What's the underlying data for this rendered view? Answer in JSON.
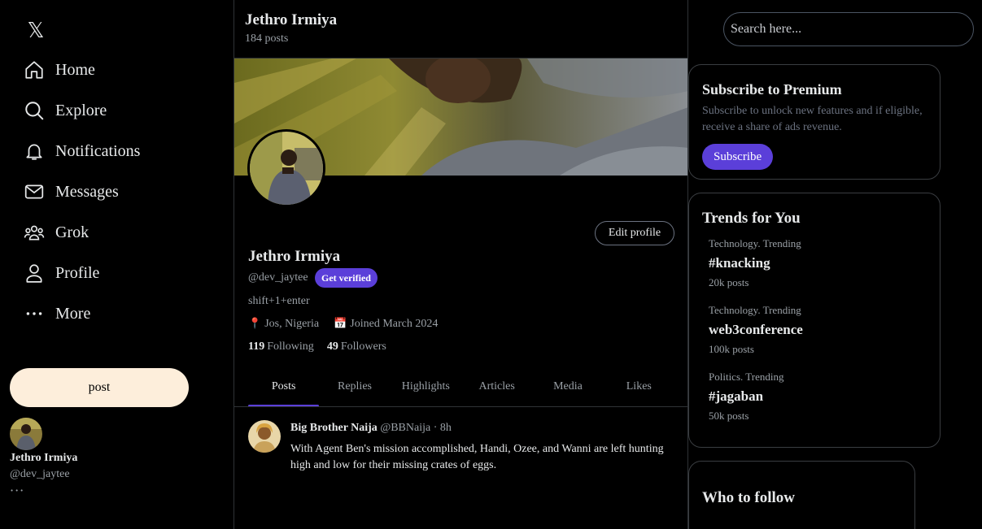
{
  "sidebar": {
    "logo": "𝕏",
    "items": [
      {
        "label": "Home",
        "icon": "home-icon"
      },
      {
        "label": "Explore",
        "icon": "search-icon"
      },
      {
        "label": "Notifications",
        "icon": "bell-icon"
      },
      {
        "label": "Messages",
        "icon": "mail-icon"
      },
      {
        "label": "Grok",
        "icon": "people-icon"
      },
      {
        "label": "Profile",
        "icon": "user-icon"
      },
      {
        "label": "More",
        "icon": "more-icon"
      }
    ],
    "post_label": "post",
    "account": {
      "name": "Jethro Irmiya",
      "handle": "@dev_jaytee",
      "more": "···"
    }
  },
  "header": {
    "title": "Jethro Irmiya",
    "subtitle": "184 posts"
  },
  "profile": {
    "edit_label": "Edit profile",
    "name": "Jethro Irmiya",
    "handle": "@dev_jaytee",
    "verified_label": "Get verified",
    "bio": "shift+1+enter",
    "location_icon": "📍",
    "location": "Jos, Nigeria",
    "joined_icon": "📅",
    "joined": "Joined March 2024",
    "following_count": "119",
    "following_label": "Following",
    "followers_count": "49",
    "followers_label": "Followers"
  },
  "tabs": [
    {
      "label": "Posts",
      "active": true
    },
    {
      "label": "Replies"
    },
    {
      "label": "Highlights"
    },
    {
      "label": "Articles"
    },
    {
      "label": "Media"
    },
    {
      "label": "Likes"
    }
  ],
  "tweet": {
    "author": "Big Brother Naija",
    "handle": "@BBNaija",
    "sep": "·",
    "time": "8h",
    "text": "With Agent Ben's mission accomplished, Handi, Ozee, and Wanni are left hunting high and low for their missing crates of eggs."
  },
  "right": {
    "search_placeholder": "Search here...",
    "premium": {
      "title": "Subscribe to Premium",
      "text": "Subscribe to unlock new features and if eligible, receive a share of ads revenue.",
      "button": "Subscribe"
    },
    "trends": {
      "title": "Trends for You",
      "items": [
        {
          "category": "Technology. Trending",
          "name": "#knacking",
          "count": "20k posts"
        },
        {
          "category": "Technology. Trending",
          "name": "web3conference",
          "count": "100k posts"
        },
        {
          "category": "Politics. Trending",
          "name": "#jagaban",
          "count": "50k posts"
        }
      ]
    },
    "who_to_follow": {
      "title": "Who to follow"
    }
  },
  "colors": {
    "accent": "#5b3fd9",
    "post_button": "#fdeedb",
    "background": "#000000"
  }
}
